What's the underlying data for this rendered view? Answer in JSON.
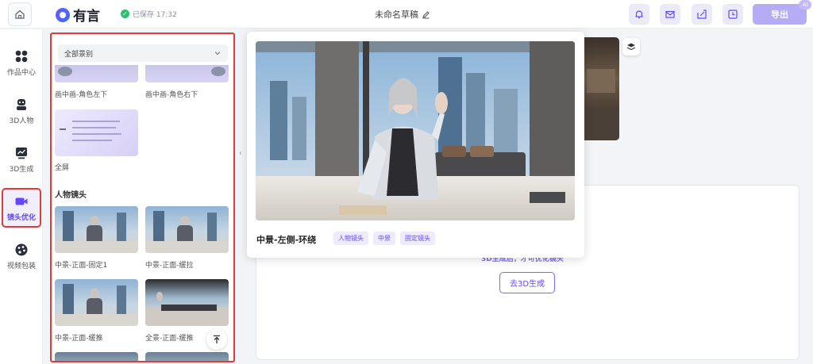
{
  "topbar": {
    "logo_text": "有言",
    "saved_text": "已保存 17:32",
    "doc_title": "未命名草稿",
    "export_label": "导出",
    "ai_badge": "AI",
    "icons": [
      "bell-icon",
      "mail-icon",
      "share-icon",
      "history-icon"
    ]
  },
  "nav": {
    "items": [
      {
        "label": "作品中心",
        "icon": "grid-icon"
      },
      {
        "label": "3D人物",
        "icon": "robot-icon"
      },
      {
        "label": "3D生成",
        "icon": "chart-icon"
      },
      {
        "label": "镜头优化",
        "icon": "camera-icon",
        "active": true
      },
      {
        "label": "视频包装",
        "icon": "palette-icon"
      }
    ]
  },
  "lens_panel": {
    "filter_value": "全部景别",
    "top_items": [
      "画中画-角色左下",
      "画中画-角色右下"
    ],
    "fullscreen_label": "全屏",
    "section_title": "人物镜头",
    "items": [
      "中景-正面-固定1",
      "中景-正面-缓拉",
      "中景-正面-缓推",
      "全景-正面-缓推"
    ]
  },
  "popover": {
    "title": "中景-左侧-环绕",
    "tags": [
      "人物镜头",
      "中景",
      "固定镜头"
    ]
  },
  "canvas": {
    "empty_tip": "3D生成后，才可优化镜头",
    "goto_button": "去3D生成"
  },
  "colors": {
    "accent": "#6448ff",
    "highlight_border": "#e53935",
    "export_button": "#b6acf5"
  }
}
